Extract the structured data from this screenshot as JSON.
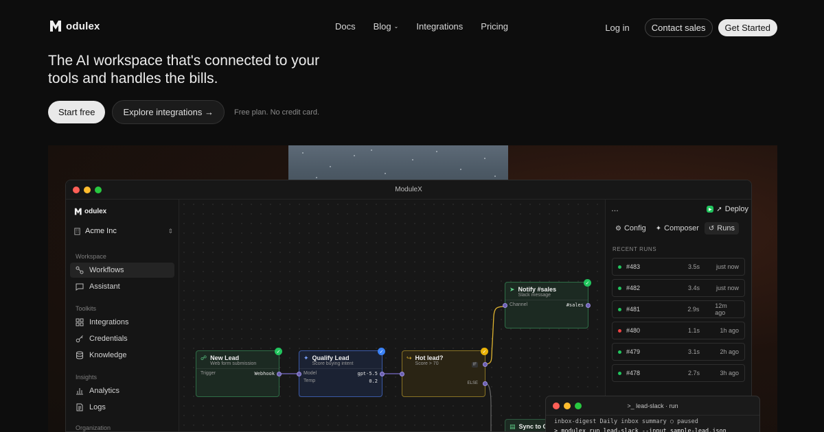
{
  "nav": {
    "brand": "odulex",
    "links": [
      "Docs",
      "Blog",
      "Integrations",
      "Pricing"
    ],
    "login": "Log in",
    "contact": "Contact sales",
    "get_started": "Get Started"
  },
  "hero": {
    "title": "The AI workspace that's connected to your tools and handles the bills.",
    "start": "Start free",
    "explore": "Explore integrations →",
    "note": "Free plan. No credit card."
  },
  "window": {
    "title": "ModuleX",
    "brand": "odulex",
    "org": "Acme Inc",
    "sections": {
      "workspace": "Workspace",
      "toolkits": "Toolkits",
      "insights": "Insights",
      "organization": "Organization"
    },
    "items": {
      "workflows": "Workflows",
      "assistant": "Assistant",
      "integrations": "Integrations",
      "credentials": "Credentials",
      "knowledge": "Knowledge",
      "analytics": "Analytics",
      "logs": "Logs"
    }
  },
  "nodes": {
    "new_lead": {
      "title": "New Lead",
      "sub": "Web form submission",
      "k1": "Trigger",
      "v1": "Webhook"
    },
    "qualify": {
      "title": "Qualify Lead",
      "sub": "Score buying intent",
      "k1": "Model",
      "v1": "gpt-5.5",
      "k2": "Temp",
      "v2": "0.2"
    },
    "hot": {
      "title": "Hot lead?",
      "sub": "Score > 70",
      "if": "IF",
      "else": "ELSE"
    },
    "notify": {
      "title": "Notify #sales",
      "sub": "Slack message",
      "k1": "Channel",
      "v1": "#sales"
    },
    "sync": {
      "title": "Sync to C"
    }
  },
  "panel": {
    "more": "…",
    "deploy": "Deploy",
    "tabs": [
      "Config",
      "Composer",
      "Runs"
    ],
    "recent_title": "RECENT RUNS",
    "runs": [
      {
        "id": "#483",
        "dur": "3.5s",
        "when": "just now",
        "status": "ok"
      },
      {
        "id": "#482",
        "dur": "3.4s",
        "when": "just now",
        "status": "ok"
      },
      {
        "id": "#481",
        "dur": "2.9s",
        "when": "12m ago",
        "status": "ok"
      },
      {
        "id": "#480",
        "dur": "1.1s",
        "when": "1h ago",
        "status": "fail"
      },
      {
        "id": "#479",
        "dur": "3.1s",
        "when": "2h ago",
        "status": "ok"
      },
      {
        "id": "#478",
        "dur": "2.7s",
        "when": "3h ago",
        "status": "ok"
      }
    ]
  },
  "terminal": {
    "title": ">_ lead-slack · run",
    "line1": "inbox-digest  Daily inbox summary   ○ paused",
    "line2": "> modulex run lead-slack --input sample-lead.json"
  },
  "colors": {
    "accent_green": "#22c55e",
    "accent_blue": "#3b82f6",
    "accent_amber": "#eab308",
    "fail_red": "#ef4444"
  }
}
